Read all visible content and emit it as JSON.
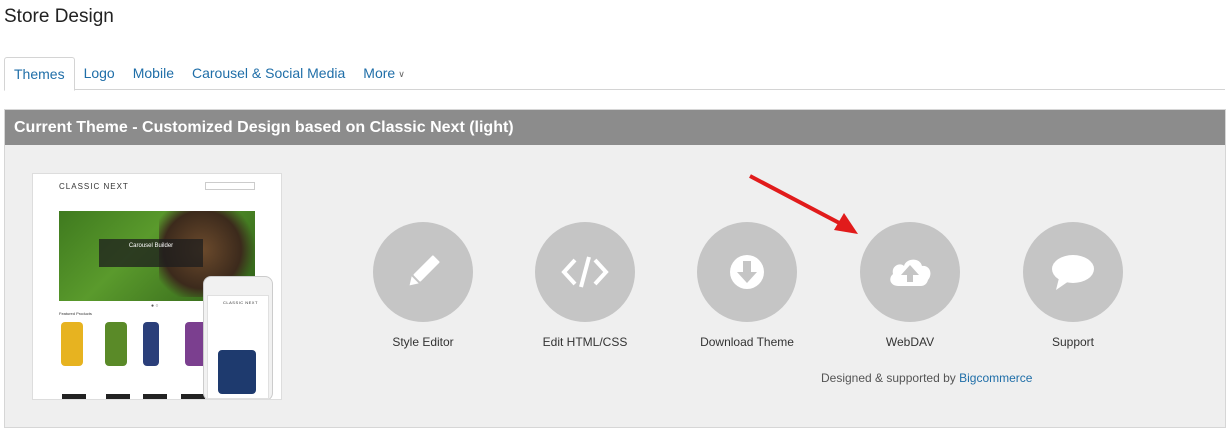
{
  "page": {
    "title": "Store Design"
  },
  "tabs": [
    {
      "label": "Themes",
      "active": true
    },
    {
      "label": "Logo"
    },
    {
      "label": "Mobile"
    },
    {
      "label": "Carousel & Social Media"
    },
    {
      "label": "More"
    }
  ],
  "panel": {
    "header": "Current Theme - Customized Design based on Classic Next (light)",
    "preview": {
      "logo": "CLASSIC NEXT",
      "carousel_title": "Carousel Builder",
      "featured_label": "Featured Products"
    },
    "actions": [
      {
        "label": "Style Editor",
        "icon": "pencil-icon"
      },
      {
        "label": "Edit HTML/CSS",
        "icon": "code-icon"
      },
      {
        "label": "Download Theme",
        "icon": "download-icon"
      },
      {
        "label": "WebDAV",
        "icon": "cloud-upload-icon"
      },
      {
        "label": "Support",
        "icon": "speech-bubble-icon"
      }
    ],
    "credit_text": "Designed & supported by",
    "credit_link": "Bigcommerce"
  },
  "colors": {
    "header_bg": "#8c8c8c",
    "link": "#1f6ea8",
    "circle": "#c5c5c5",
    "annotation_arrow": "#e11b1b"
  }
}
